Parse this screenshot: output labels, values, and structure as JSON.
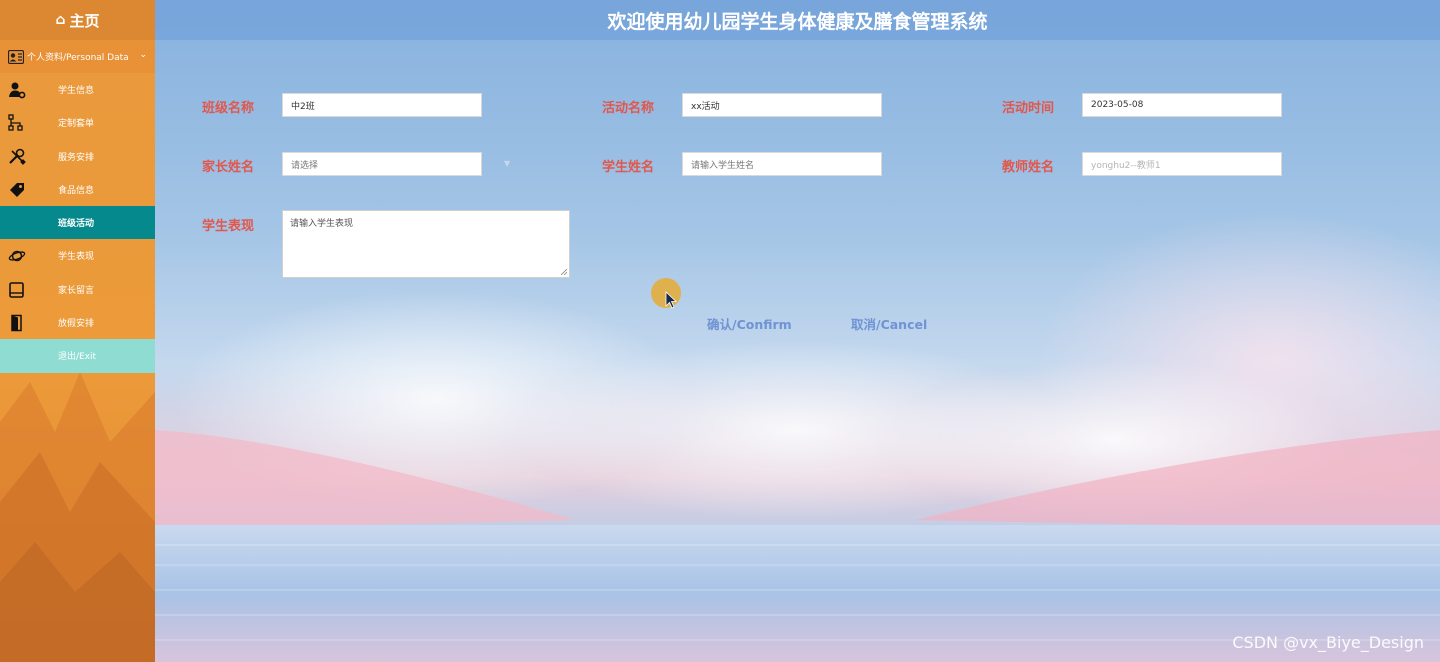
{
  "sidebar": {
    "home": "主页",
    "profile": "个人资料/Personal Data",
    "items": [
      {
        "label": "学生信息",
        "icon": "user-gear-icon"
      },
      {
        "label": "定制套单",
        "icon": "sitemap-icon"
      },
      {
        "label": "服务安排",
        "icon": "tools-icon"
      },
      {
        "label": "食品信息",
        "icon": "tag-icon"
      },
      {
        "label": "班级活动",
        "icon": "none",
        "active": true
      },
      {
        "label": "学生表现",
        "icon": "planet-icon"
      },
      {
        "label": "家长留言",
        "icon": "book-icon"
      },
      {
        "label": "放假安排",
        "icon": "door-icon"
      },
      {
        "label": "退出/Exit",
        "icon": "none",
        "exit": true
      }
    ]
  },
  "header": {
    "title": "欢迎使用幼儿园学生身体健康及膳食管理系统"
  },
  "form": {
    "class_name_label": "班级名称",
    "class_name_value": "中2班",
    "activity_name_label": "活动名称",
    "activity_name_value": "xx活动",
    "activity_time_label": "活动时间",
    "activity_time_value": "2023-05-08",
    "parent_name_label": "家长姓名",
    "parent_name_placeholder": "请选择",
    "student_name_label": "学生姓名",
    "student_name_placeholder": "请输入学生姓名",
    "teacher_name_label": "教师姓名",
    "teacher_name_value": "yonghu2--教师1",
    "performance_label": "学生表现",
    "performance_placeholder": "请输入学生表现"
  },
  "buttons": {
    "confirm": "确认/Confirm",
    "cancel": "取消/Cancel"
  },
  "watermark": "CSDN @vx_Biye_Design",
  "colors": {
    "sidebar_bg": "#ec9a3a",
    "active_item": "#05898d",
    "exit_item": "#8fdcd3",
    "header_bg": "#76a3da",
    "label": "#e2574c",
    "button_text": "#6f93d3"
  }
}
